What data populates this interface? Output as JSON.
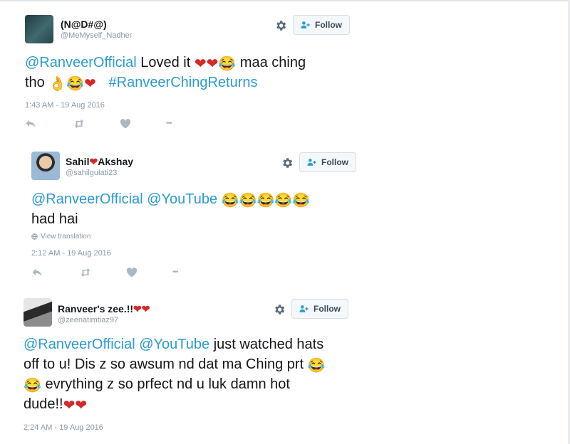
{
  "colors": {
    "mention": "#2b9bd1",
    "heart": "#d42a2a",
    "meta": "#8899a6"
  },
  "icons": {
    "more": "•••"
  },
  "tweets": [
    {
      "name": "(N@D#@)",
      "handle": "@MeMyself_Nadher",
      "follow": "Follow",
      "line1": {
        "mention": "@RanveerOfficial",
        "text_a": "Loved it",
        "emojis": "❤❤😂",
        "text_b": "maa ching"
      },
      "line2": {
        "text_a": "tho",
        "emojis": "👌😂❤",
        "hashtag": "#RanveerChingReturns"
      },
      "time": "1:43 AM - 19 Aug 2016"
    },
    {
      "name": "Sahil",
      "name_emoji": "❤",
      "name_b": "Akshay",
      "handle": "@sahilgulati23",
      "follow": "Follow",
      "line1": {
        "mention1": "@RanveerOfficial",
        "mention2": "@YouTube",
        "emojis": "😂😂😂😂😂"
      },
      "line2": {
        "text": "had hai"
      },
      "view_translation": "View translation",
      "time": "2:12 AM - 19 Aug 2016"
    },
    {
      "name": "Ranveer's zee.!!",
      "name_emoji": "❤❤",
      "handle": "@zeenatimtiaz97",
      "follow": "Follow",
      "line1": {
        "mention1": "@RanveerOfficial",
        "mention2": "@YouTube",
        "text": "just watched hats"
      },
      "line2": {
        "text": "off to u! Dis z so awsum nd dat ma Ching prt",
        "emoji": "😂"
      },
      "line3": {
        "emoji": "😂",
        "text": "evrything z so prfect nd u luk damn hot"
      },
      "line4": {
        "text": "dude!!",
        "emojis": "❤❤"
      },
      "time": "2:24 AM - 19 Aug 2016"
    }
  ]
}
